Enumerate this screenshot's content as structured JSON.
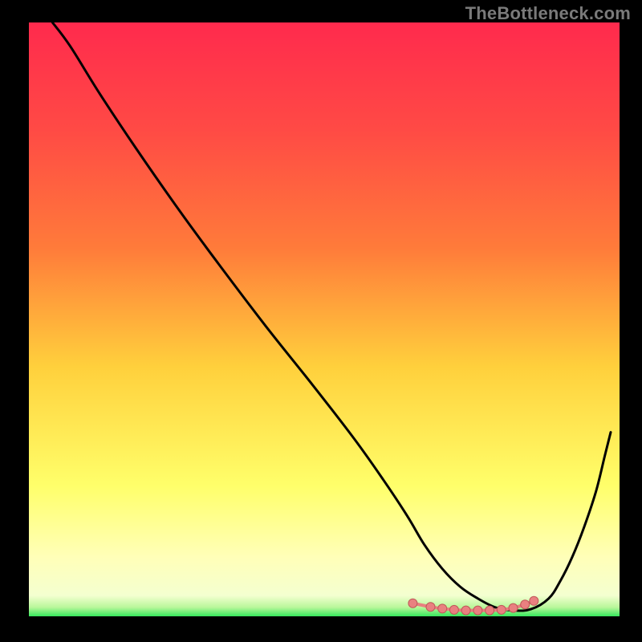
{
  "watermark": "TheBottleneck.com",
  "colors": {
    "background": "#000000",
    "gradient_top": "#ff2a4d",
    "gradient_mid1": "#ff7b3a",
    "gradient_mid2": "#ffd03c",
    "gradient_low": "#ffff6a",
    "gradient_pale": "#ffffb8",
    "gradient_bottom": "#36e85d",
    "curve": "#000000",
    "marker_fill": "#e98080",
    "marker_stroke": "#c05858"
  },
  "chart_data": {
    "type": "line",
    "title": "",
    "xlabel": "",
    "ylabel": "",
    "xlim": [
      0,
      100
    ],
    "ylim": [
      0,
      100
    ],
    "curve": {
      "x": [
        4,
        7,
        12,
        18,
        25,
        32,
        40,
        48,
        55,
        60,
        64,
        67,
        70,
        73,
        76,
        79,
        82,
        85,
        88,
        90,
        92,
        94,
        96,
        97.5,
        98.5
      ],
      "y": [
        100,
        96,
        88,
        79,
        69,
        59.5,
        49,
        39,
        30,
        23,
        17,
        12,
        8,
        5,
        3,
        1.5,
        1,
        1.2,
        3,
        6,
        10,
        15,
        21,
        27,
        31
      ]
    },
    "markers": {
      "x": [
        65,
        68,
        70,
        72,
        74,
        76,
        78,
        80,
        82,
        84,
        85.5
      ],
      "y": [
        2.2,
        1.6,
        1.3,
        1.1,
        1.0,
        1.0,
        1.0,
        1.1,
        1.4,
        2.0,
        2.6
      ]
    }
  }
}
